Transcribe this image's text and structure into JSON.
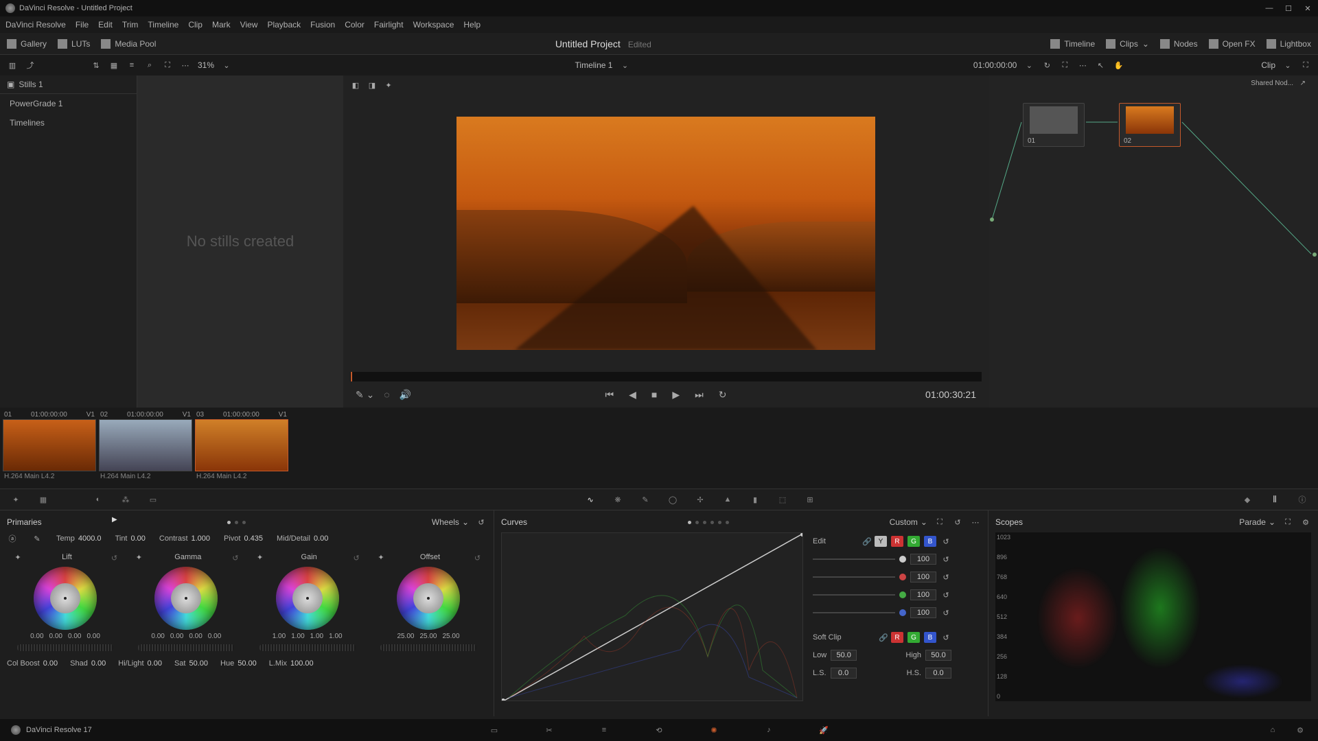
{
  "titlebar": {
    "text": "DaVinci Resolve - Untitled Project"
  },
  "menu": [
    "DaVinci Resolve",
    "File",
    "Edit",
    "Trim",
    "Timeline",
    "Clip",
    "Mark",
    "View",
    "Playback",
    "Fusion",
    "Color",
    "Fairlight",
    "Workspace",
    "Help"
  ],
  "topbar": {
    "left": [
      {
        "name": "gallery",
        "label": "Gallery"
      },
      {
        "name": "luts",
        "label": "LUTs"
      },
      {
        "name": "media-pool",
        "label": "Media Pool"
      }
    ],
    "project": "Untitled Project",
    "edited": "Edited",
    "right": [
      {
        "name": "timeline",
        "label": "Timeline"
      },
      {
        "name": "clips",
        "label": "Clips"
      },
      {
        "name": "nodes",
        "label": "Nodes"
      },
      {
        "name": "openfx",
        "label": "Open FX"
      },
      {
        "name": "lightbox",
        "label": "Lightbox"
      }
    ]
  },
  "subbar": {
    "zoom": "31%",
    "timeline": "Timeline 1",
    "timecode": "01:00:00:00",
    "clip_label": "Clip"
  },
  "sidebar": {
    "header": "Stills 1",
    "items": [
      "PowerGrade 1",
      "Timelines"
    ]
  },
  "stills_empty": "No stills created",
  "viewer": {
    "timecode": "01:00:30:21"
  },
  "nodes": {
    "shared_label": "Shared Nod...",
    "n1": "01",
    "n2": "02"
  },
  "clips": [
    {
      "num": "01",
      "tc": "01:00:00:00",
      "track": "V1",
      "codec": "H.264 Main L4.2"
    },
    {
      "num": "02",
      "tc": "01:00:00:00",
      "track": "V1",
      "codec": "H.264 Main L4.2"
    },
    {
      "num": "03",
      "tc": "01:00:00:00",
      "track": "V1",
      "codec": "H.264 Main L4.2"
    }
  ],
  "primaries": {
    "title": "Primaries",
    "wheels_label": "Wheels",
    "adjust": {
      "temp_l": "Temp",
      "temp_v": "4000.0",
      "tint_l": "Tint",
      "tint_v": "0.00",
      "contrast_l": "Contrast",
      "contrast_v": "1.000",
      "pivot_l": "Pivot",
      "pivot_v": "0.435",
      "md_l": "Mid/Detail",
      "md_v": "0.00"
    },
    "wheels": [
      {
        "name": "Lift",
        "vals": [
          "0.00",
          "0.00",
          "0.00",
          "0.00"
        ]
      },
      {
        "name": "Gamma",
        "vals": [
          "0.00",
          "0.00",
          "0.00",
          "0.00"
        ]
      },
      {
        "name": "Gain",
        "vals": [
          "1.00",
          "1.00",
          "1.00",
          "1.00"
        ]
      },
      {
        "name": "Offset",
        "vals": [
          "25.00",
          "25.00",
          "25.00"
        ]
      }
    ],
    "bottom": {
      "cb_l": "Col Boost",
      "cb_v": "0.00",
      "sh_l": "Shad",
      "sh_v": "0.00",
      "hl_l": "Hi/Light",
      "hl_v": "0.00",
      "sat_l": "Sat",
      "sat_v": "50.00",
      "hue_l": "Hue",
      "hue_v": "50.00",
      "lm_l": "L.Mix",
      "lm_v": "100.00"
    }
  },
  "curves": {
    "title": "Curves",
    "custom": "Custom",
    "edit": "Edit",
    "channels": {
      "y": "Y",
      "r": "R",
      "g": "G",
      "b": "B"
    },
    "intensity": [
      "100",
      "100",
      "100",
      "100"
    ],
    "softclip": "Soft Clip",
    "low_l": "Low",
    "low_v": "50.0",
    "high_l": "High",
    "high_v": "50.0",
    "ls_l": "L.S.",
    "ls_v": "0.0",
    "hs_l": "H.S.",
    "hs_v": "0.0"
  },
  "scopes": {
    "title": "Scopes",
    "mode": "Parade",
    "scale": [
      "1023",
      "896",
      "768",
      "640",
      "512",
      "384",
      "256",
      "128",
      "0"
    ]
  },
  "bottombar": {
    "app": "DaVinci Resolve 17"
  }
}
